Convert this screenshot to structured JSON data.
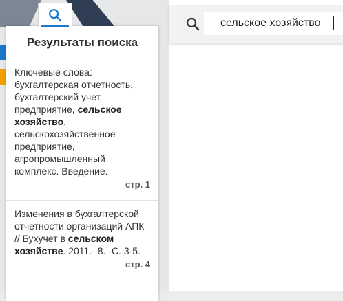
{
  "search": {
    "query": "сельское хозяйство"
  },
  "results_panel": {
    "title": "Результаты поиска",
    "results": [
      {
        "parts": [
          "Ключевые слова: бухгалтерская отчетность, бухгалтерский учет, предприятие, ",
          "сельское хозяйство",
          ", сельскохозяйственное предприятие, агропромышленный комплекс. Введение."
        ],
        "page": "стр. 1"
      },
      {
        "parts": [
          "Изменения в бухгалтерской отчетности организаций АПК // Бухучет в ",
          "сельском хозяйстве",
          ". 2011.- 8. -С. 3-5."
        ],
        "page": "стр. 4"
      }
    ]
  },
  "colors": {
    "accent_blue": "#1c78c9",
    "accent_orange": "#f2a100",
    "dark_navy": "#2f3e55"
  },
  "icons": [
    "search-icon"
  ]
}
